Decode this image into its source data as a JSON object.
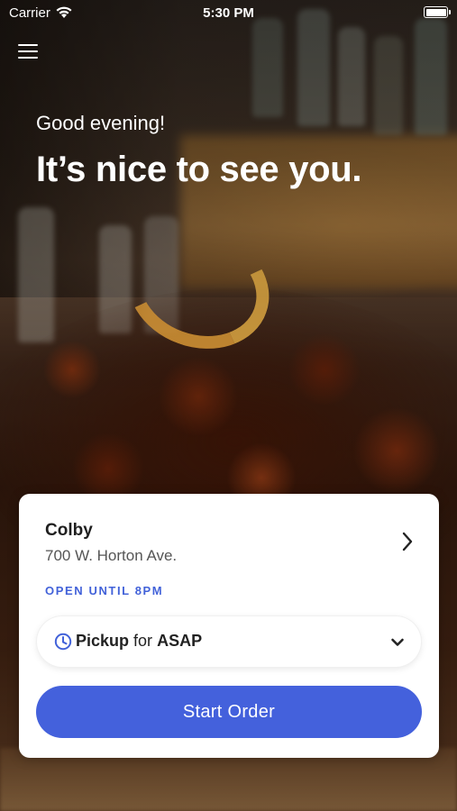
{
  "status_bar": {
    "carrier": "Carrier",
    "time": "5:30 PM"
  },
  "header": {
    "menu_icon": "hamburger-menu-icon",
    "greeting": "Good evening!",
    "headline": "It’s nice to see you."
  },
  "location_card": {
    "store_name": "Colby",
    "store_address": "700 W. Horton Ave.",
    "open_status": "OPEN UNTIL 8PM",
    "order_type": {
      "icon": "clock-icon",
      "mode": "Pickup",
      "connector": "for",
      "timing": "ASAP"
    },
    "start_button_label": "Start Order"
  },
  "colors": {
    "accent": "#4461dc",
    "open_status": "#4262d9",
    "card_background": "#ffffff"
  }
}
